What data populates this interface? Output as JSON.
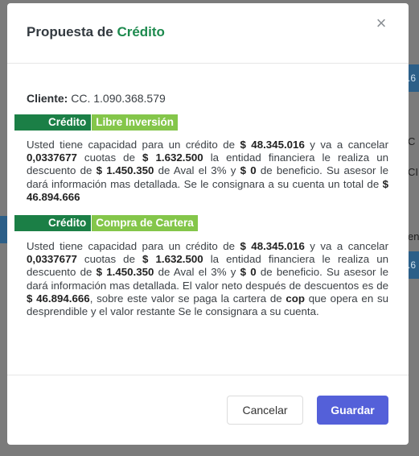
{
  "background": {
    "chip_1": ".6",
    "chip_2": ".6",
    "text_1": "C",
    "text_2": "CI",
    "text_3": "en"
  },
  "modal": {
    "title_prefix": "Propuesta de",
    "title_accent": "Crédito",
    "close_glyph": "×",
    "client": {
      "label": "Cliente:",
      "value": "CC. 1.090.368.579"
    },
    "sections": [
      {
        "tag_dark": "Crédito",
        "tag_light": "Libre Inversión",
        "text_1": "Usted tiene capacidad para un crédito de ",
        "amount_credit": "$ 48.345.016",
        "text_2": " y va a cancelar ",
        "installments": "0,0337677",
        "text_3": " cuotas de ",
        "installment_value": "$ 1.632.500",
        "text_4": " la entidad financiera le realiza un descuento de ",
        "discount": "$ 1.450.350",
        "text_5": " de Aval el 3% y ",
        "benefit": "$ 0",
        "text_6": " de beneficio. Su asesor le dará información mas detallada. Se le consignara a su cuenta un total de ",
        "total": "$ 46.894.666"
      },
      {
        "tag_dark": "Crédito",
        "tag_light": "Compra de Cartera",
        "text_1": "Usted tiene capacidad para un crédito de ",
        "amount_credit": "$ 48.345.016",
        "text_2": " y va a cancelar ",
        "installments": "0,0337677",
        "text_3": " cuotas de ",
        "installment_value": "$ 1.632.500",
        "text_4": " la entidad financiera le realiza un descuento de ",
        "discount": "$ 1.450.350",
        "text_5": " de Aval el 3% y ",
        "benefit": "$ 0",
        "text_6": " de beneficio. Su asesor le dará información mas detallada. El valor neto después de descuentos es de ",
        "net": "$ 46.894.666",
        "text_7": ", sobre este valor se paga la cartera de ",
        "entity": "cop",
        "text_8": " que opera en su desprendible y el valor restante Se le consignara a su cuenta."
      }
    ],
    "footer": {
      "cancel_label": "Cancelar",
      "save_label": "Guardar"
    }
  },
  "colors": {
    "accent_green": "#1d8a4e",
    "tag_dark": "#1b7f46",
    "tag_light": "#84c64a",
    "primary_button": "#5460d9",
    "backdrop": "#7b7b7b"
  }
}
